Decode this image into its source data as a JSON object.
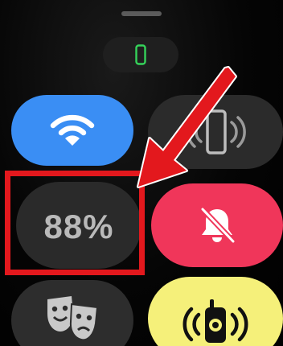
{
  "control_center": {
    "phone_status_icon": "phone-outline-icon",
    "tiles": {
      "wifi": {
        "icon": "wifi-icon",
        "color": "#3a8ef4"
      },
      "ping_iphone": {
        "icon": "phone-ping-icon",
        "color": "#2b2b2b"
      },
      "battery": {
        "label": "88%",
        "color": "#2a2a2a"
      },
      "silent_mode": {
        "icon": "bell-slash-icon",
        "color": "#f0365a"
      },
      "theater_mode": {
        "icon": "theater-masks-icon",
        "color": "#2d2d2d"
      },
      "walkie_talkie": {
        "icon": "walkie-talkie-icon",
        "color": "#f5f07a"
      }
    }
  },
  "annotation": {
    "highlight_color": "#e3181d",
    "arrow_color": "#e3181d"
  }
}
